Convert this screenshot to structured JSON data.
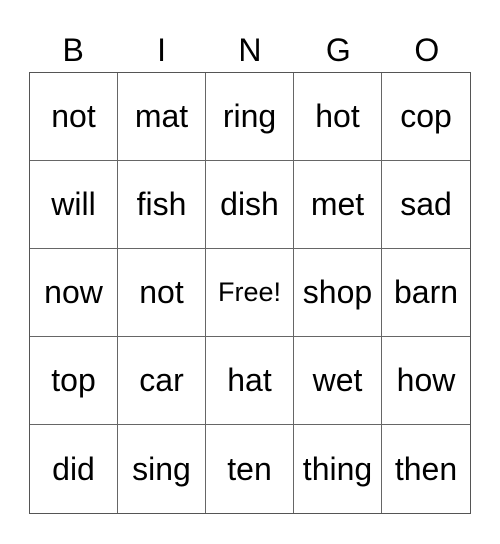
{
  "header": [
    "B",
    "I",
    "N",
    "G",
    "O"
  ],
  "rows": [
    [
      "not",
      "mat",
      "ring",
      "hot",
      "cop"
    ],
    [
      "will",
      "fish",
      "dish",
      "met",
      "sad"
    ],
    [
      "now",
      "not",
      "Free!",
      "shop",
      "barn"
    ],
    [
      "top",
      "car",
      "hat",
      "wet",
      "how"
    ],
    [
      "did",
      "sing",
      "ten",
      "thing",
      "then"
    ]
  ]
}
